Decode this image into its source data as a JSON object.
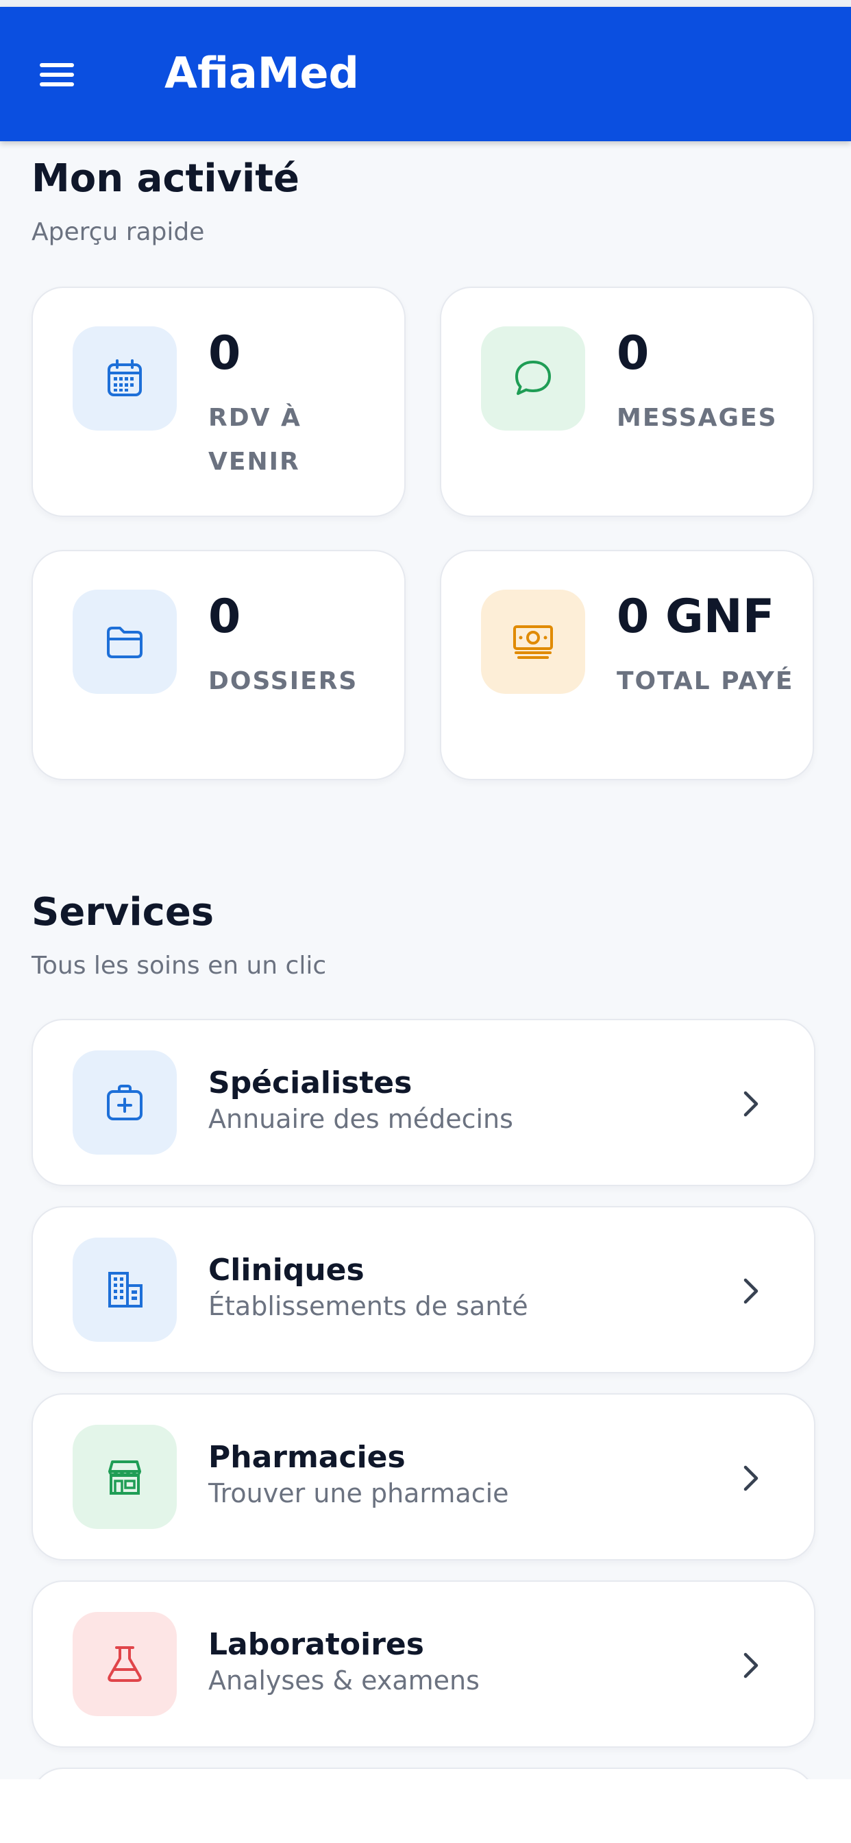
{
  "header": {
    "title": "AfiaMed",
    "menu_icon": "hamburger-menu-icon"
  },
  "activity": {
    "title": "Mon activité",
    "subtitle": "Aperçu rapide",
    "cards": [
      {
        "value": "0",
        "label": "RDV À VENIR",
        "icon": "calendar-icon",
        "color": "#1d6fd8"
      },
      {
        "value": "0",
        "label": "MESSAGES",
        "icon": "chat-bubble-icon",
        "color": "#1f9d55"
      },
      {
        "value": "0",
        "label": "DOSSIERS",
        "icon": "folder-icon",
        "color": "#1d6fd8"
      },
      {
        "value": "0 GNF",
        "label": "TOTAL PAYÉ",
        "icon": "banknote-icon",
        "color": "#e08a00"
      }
    ]
  },
  "services": {
    "title": "Services",
    "subtitle": "Tous les soins en un clic",
    "items": [
      {
        "title": "Spécialistes",
        "subtitle": "Annuaire des médecins",
        "icon": "medical-kit-icon",
        "color": "#1d6fd8"
      },
      {
        "title": "Cliniques",
        "subtitle": "Établissements de santé",
        "icon": "building-icon",
        "color": "#1d6fd8"
      },
      {
        "title": "Pharmacies",
        "subtitle": "Trouver une pharmacie",
        "icon": "storefront-icon",
        "color": "#1f9d55"
      },
      {
        "title": "Laboratoires",
        "subtitle": "Analyses & examens",
        "icon": "flask-icon",
        "color": "#e0454a"
      }
    ]
  },
  "colors": {
    "primary": "#0b4fe0",
    "background": "#f6f8fb",
    "text": "#0f172a",
    "muted": "#6b7280"
  }
}
